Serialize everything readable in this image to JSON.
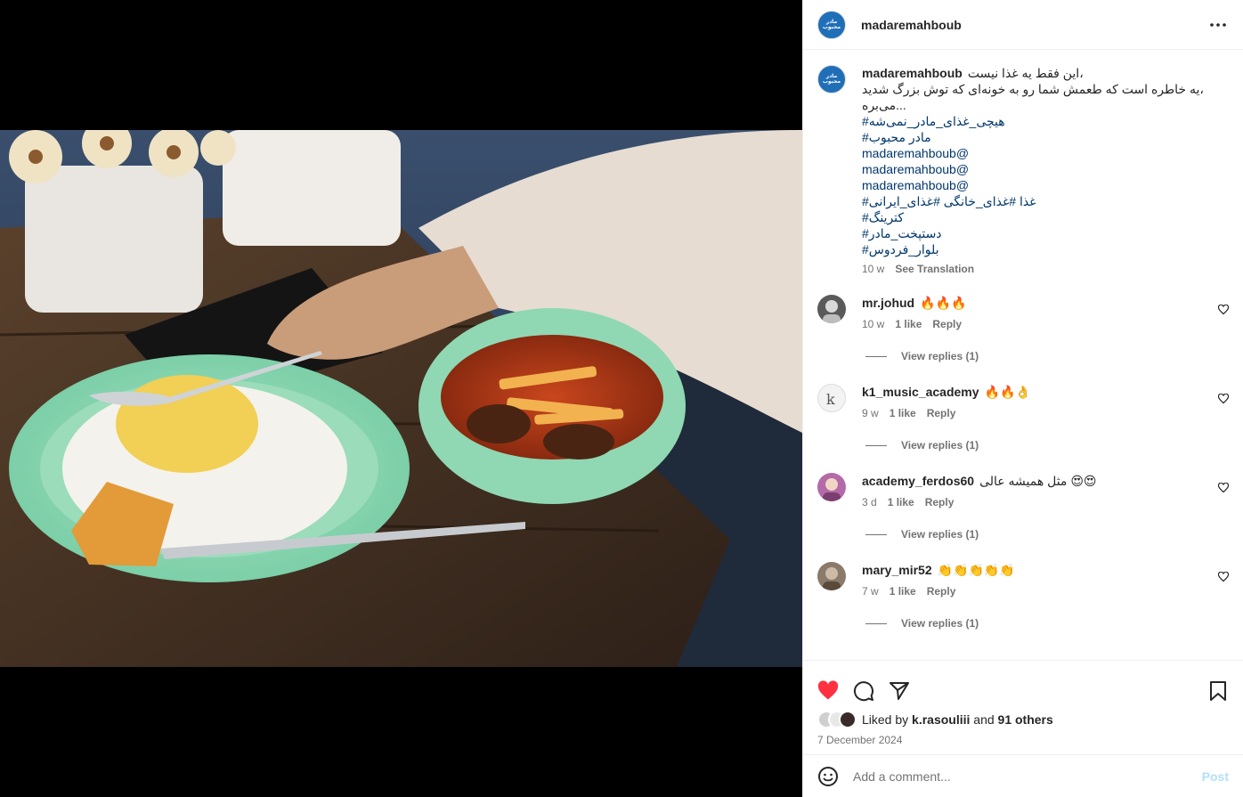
{
  "post": {
    "username": "madaremahboub",
    "brand_avatar_text": "مادر محبوب",
    "caption": {
      "username": "madaremahboub",
      "lines": [
        "این فقط یه غذا نیست،",
        "یه خاطره است که طعمش شما رو به خونه‌ای که توش بزرگ شدید،",
        "می‌بره..."
      ],
      "tags": [
        "#هیچی_غذای_مادر_نمی‌شه",
        "#مادر محبوب",
        "madaremahboub@",
        "madaremahboub@",
        "madaremahboub@",
        "#غذا #غذای_خانگی #غذای_ایرانی",
        "#کترینگ",
        "#دستپخت_مادر",
        "#بلوار_فردوس"
      ],
      "time": "10 w",
      "see_translation": "See Translation"
    },
    "comments": [
      {
        "user": "mr.johud",
        "text": "🔥🔥🔥",
        "time": "10 w",
        "likes": "1 like",
        "reply": "Reply",
        "view_replies": "View replies (1)",
        "avatar_color": "#5a5a5a"
      },
      {
        "user": "k1_music_academy",
        "text": "🔥🔥👌",
        "time": "9 w",
        "likes": "1 like",
        "reply": "Reply",
        "view_replies": "View replies (1)",
        "avatar_color": "#f3f3f3"
      },
      {
        "user": "academy_ferdos60",
        "text": "😍😍 مثل همیشه عالی",
        "time": "3 d",
        "likes": "1 like",
        "reply": "Reply",
        "view_replies": "View replies (1)",
        "avatar_color": "#b56aa8"
      },
      {
        "user": "mary_mir52",
        "text": "👏👏👏👏👏",
        "time": "7 w",
        "likes": "1 like",
        "reply": "Reply",
        "view_replies": "View replies (1)",
        "avatar_color": "#8a7a6a"
      }
    ],
    "likes": {
      "prefix": "Liked by",
      "user": "k.rasouliii",
      "and": "and",
      "others": "91 others"
    },
    "date": "7 December 2024",
    "add_comment": {
      "placeholder": "Add a comment...",
      "post_label": "Post"
    },
    "colors": {
      "heart_liked": "#ff3040",
      "link": "#00376b",
      "muted": "#737373",
      "post_disabled": "#b2dffc"
    },
    "icons": [
      "more-options-icon",
      "heart-icon",
      "comment-icon",
      "share-icon",
      "bookmark-icon",
      "emoji-icon"
    ]
  }
}
